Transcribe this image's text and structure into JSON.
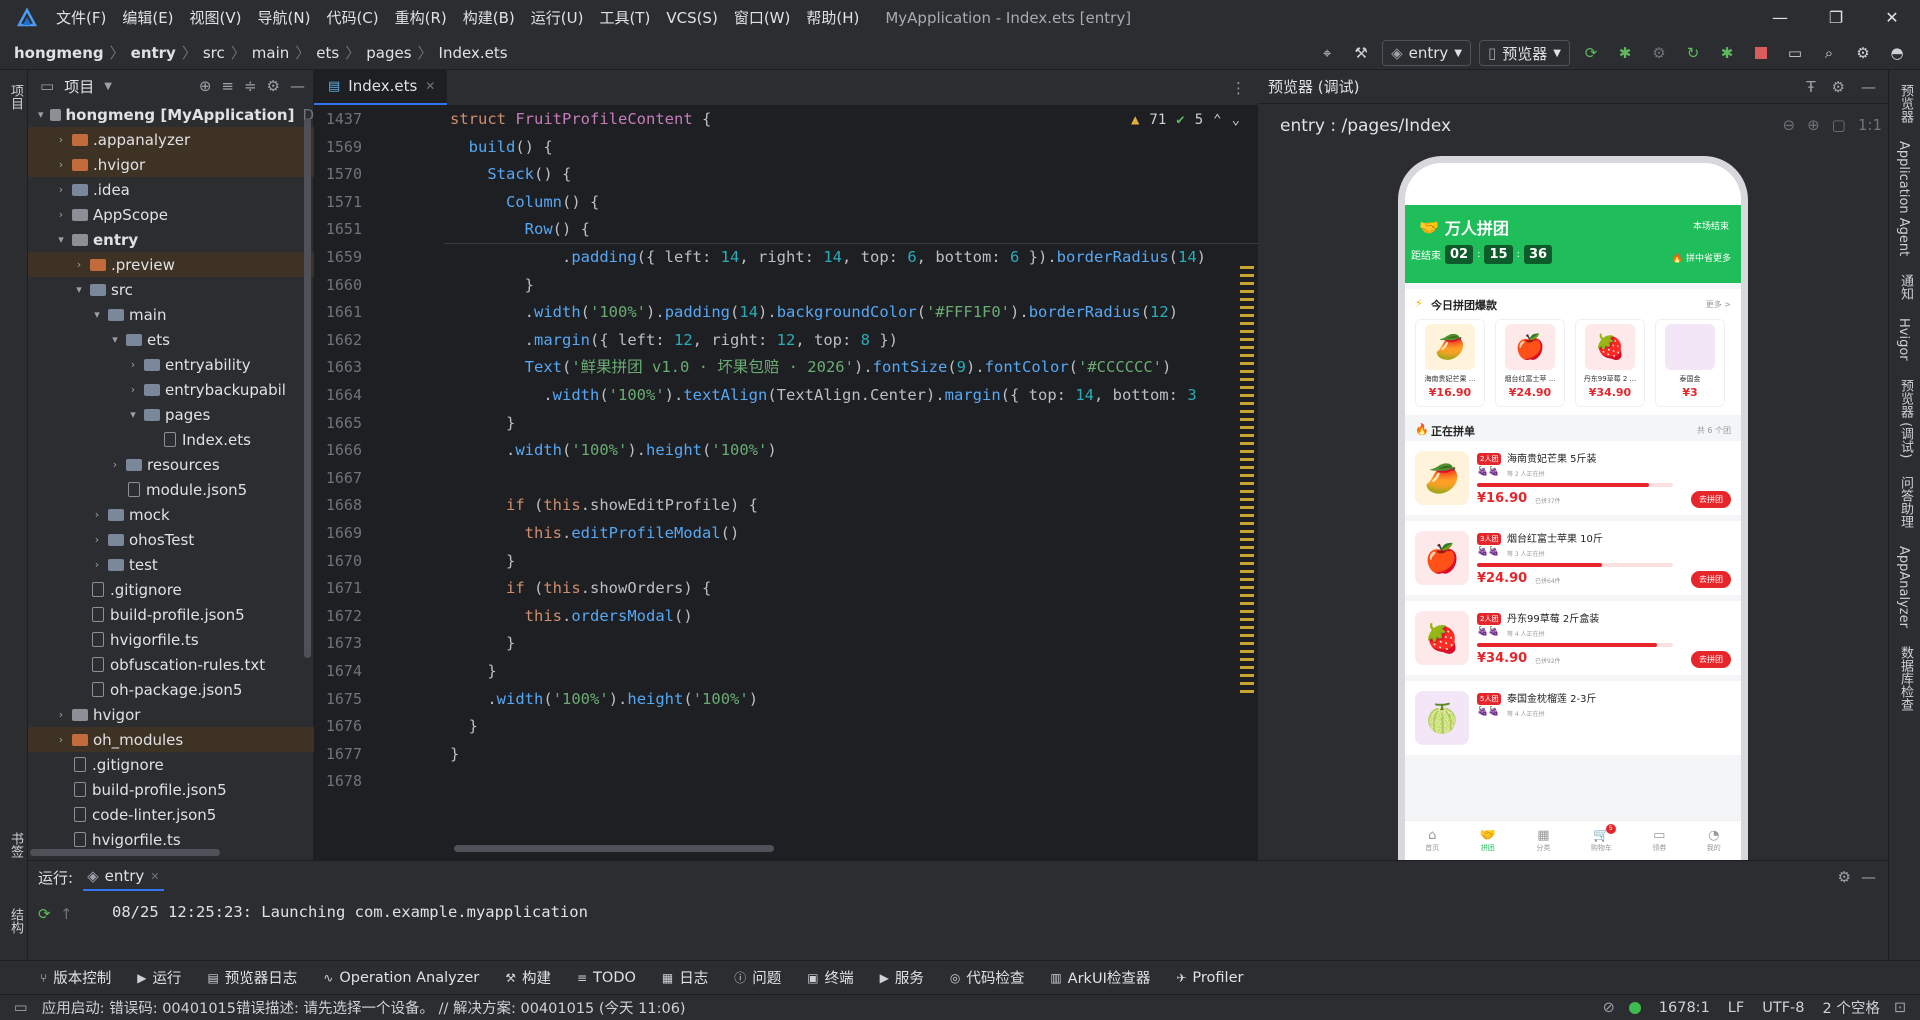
{
  "titlebar": {
    "menu": [
      "文件(F)",
      "编辑(E)",
      "视图(V)",
      "导航(N)",
      "代码(C)",
      "重构(R)",
      "构建(B)",
      "运行(U)",
      "工具(T)",
      "VCS(S)",
      "窗口(W)",
      "帮助(H)"
    ],
    "window_title": "MyApplication - Index.ets [entry]",
    "minimize": "—",
    "restore": "❐",
    "close": "✕"
  },
  "breadcrumb": [
    "hongmeng",
    "entry",
    "src",
    "main",
    "ets",
    "pages",
    "Index.ets"
  ],
  "toolbar": {
    "run_config": "entry",
    "device": "预览器"
  },
  "project": {
    "title": "项目",
    "items": [
      {
        "label": "hongmeng [MyApplication]",
        "suffix": "D",
        "depth": 0,
        "arrow": "▾",
        "icon": "gray",
        "hl": false,
        "bold": true
      },
      {
        "label": ".appanalyzer",
        "depth": 1,
        "arrow": "›",
        "icon": "orange",
        "hl": true
      },
      {
        "label": ".hvigor",
        "depth": 1,
        "arrow": "›",
        "icon": "orange",
        "hl": true
      },
      {
        "label": ".idea",
        "depth": 1,
        "arrow": "›",
        "icon": "blue",
        "hl": false
      },
      {
        "label": "AppScope",
        "depth": 1,
        "arrow": "›",
        "icon": "gray",
        "hl": false
      },
      {
        "label": "entry",
        "depth": 1,
        "arrow": "▾",
        "icon": "gray",
        "hl": false,
        "bold": true
      },
      {
        "label": ".preview",
        "depth": 2,
        "arrow": "›",
        "icon": "orange",
        "hl": true
      },
      {
        "label": "src",
        "depth": 2,
        "arrow": "▾",
        "icon": "blue",
        "hl": false
      },
      {
        "label": "main",
        "depth": 3,
        "arrow": "▾",
        "icon": "blue",
        "hl": false
      },
      {
        "label": "ets",
        "depth": 4,
        "arrow": "▾",
        "icon": "blue",
        "hl": false
      },
      {
        "label": "entryability",
        "depth": 5,
        "arrow": "›",
        "icon": "blue",
        "hl": false
      },
      {
        "label": "entrybackupabil",
        "depth": 5,
        "arrow": "›",
        "icon": "blue",
        "hl": false
      },
      {
        "label": "pages",
        "depth": 5,
        "arrow": "▾",
        "icon": "blue",
        "hl": false
      },
      {
        "label": "Index.ets",
        "depth": 6,
        "arrow": "",
        "icon": "file",
        "hl": false
      },
      {
        "label": "resources",
        "depth": 4,
        "arrow": "›",
        "icon": "blue",
        "hl": false
      },
      {
        "label": "module.json5",
        "depth": 4,
        "arrow": "",
        "icon": "file",
        "hl": false
      },
      {
        "label": "mock",
        "depth": 3,
        "arrow": "›",
        "icon": "blue",
        "hl": false
      },
      {
        "label": "ohosTest",
        "depth": 3,
        "arrow": "›",
        "icon": "blue",
        "hl": false
      },
      {
        "label": "test",
        "depth": 3,
        "arrow": "›",
        "icon": "blue",
        "hl": false
      },
      {
        "label": ".gitignore",
        "depth": 2,
        "arrow": "",
        "icon": "file",
        "hl": false
      },
      {
        "label": "build-profile.json5",
        "depth": 2,
        "arrow": "",
        "icon": "file",
        "hl": false
      },
      {
        "label": "hvigorfile.ts",
        "depth": 2,
        "arrow": "",
        "icon": "file",
        "hl": false
      },
      {
        "label": "obfuscation-rules.txt",
        "depth": 2,
        "arrow": "",
        "icon": "file",
        "hl": false
      },
      {
        "label": "oh-package.json5",
        "depth": 2,
        "arrow": "",
        "icon": "file",
        "hl": false
      },
      {
        "label": "hvigor",
        "depth": 1,
        "arrow": "›",
        "icon": "gray",
        "hl": false
      },
      {
        "label": "oh_modules",
        "depth": 1,
        "arrow": "›",
        "icon": "orange",
        "hl": true
      },
      {
        "label": ".gitignore",
        "depth": 1,
        "arrow": "",
        "icon": "file",
        "hl": false
      },
      {
        "label": "build-profile.json5",
        "depth": 1,
        "arrow": "",
        "icon": "file",
        "hl": false
      },
      {
        "label": "code-linter.json5",
        "depth": 1,
        "arrow": "",
        "icon": "file",
        "hl": false
      },
      {
        "label": "hvigorfile.ts",
        "depth": 1,
        "arrow": "",
        "icon": "file",
        "hl": false
      }
    ]
  },
  "editor": {
    "tab": "Index.ets",
    "warnings": "71",
    "ok": "5",
    "sticky": [
      {
        "ln": "1437",
        "html": "<span class='kw'>struct</span> <span class='ty'>FruitProfileContent</span> {"
      },
      {
        "ln": "1569",
        "html": "  <span class='fn'>build</span>() {"
      },
      {
        "ln": "1570",
        "html": "    <span class='fn'>Stack</span>() {"
      },
      {
        "ln": "1571",
        "html": "      <span class='fn'>Column</span>() {"
      },
      {
        "ln": "1651",
        "html": "        <span class='fn'>Row</span>() {"
      }
    ],
    "lines": [
      {
        "ln": "1659",
        "html": "            .<span class='fn'>padding</span>({ left: <span class='nm'>14</span>, right: <span class='nm'>14</span>, top: <span class='nm'>6</span>, bottom: <span class='nm'>6</span> }).<span class='fn'>borderRadius</span>(<span class='nm'>14</span>)"
      },
      {
        "ln": "1660",
        "html": "        }"
      },
      {
        "ln": "1661",
        "html": "        .<span class='fn'>width</span>(<span class='st'>'100%'</span>).<span class='fn'>padding</span>(<span class='nm'>14</span>).<span class='fn'>backgroundColor</span>(<span class='st'>'#FFF1F0'</span>).<span class='fn'>borderRadius</span>(<span class='nm'>12</span>)"
      },
      {
        "ln": "1662",
        "html": "        .<span class='fn'>margin</span>({ left: <span class='nm'>12</span>, right: <span class='nm'>12</span>, top: <span class='nm'>8</span> })"
      },
      {
        "ln": "1663",
        "html": "        <span class='fn'>Text</span>(<span class='st'>'鲜果拼团 v1.0 · 坏果包赔 · 2026'</span>).<span class='fn'>fontSize</span>(<span class='nm'>9</span>).<span class='fn'>fontColor</span>(<span class='st'>'#CCCCCC'</span>)"
      },
      {
        "ln": "1664",
        "html": "          .<span class='fn'>width</span>(<span class='st'>'100%'</span>).<span class='fn'>textAlign</span>(TextAlign.Center).<span class='fn'>margin</span>({ top: <span class='nm'>14</span>, bottom: <span class='nm'>3</span>"
      },
      {
        "ln": "1665",
        "html": "      }"
      },
      {
        "ln": "1666",
        "html": "      .<span class='fn'>width</span>(<span class='st'>'100%'</span>).<span class='fn'>height</span>(<span class='st'>'100%'</span>)"
      },
      {
        "ln": "1667",
        "html": ""
      },
      {
        "ln": "1668",
        "html": "      <span class='kw'>if</span> (<span class='kw'>this</span>.showEditProfile) {"
      },
      {
        "ln": "1669",
        "html": "        <span class='kw'>this</span>.<span class='fn'>editProfileModal</span>()"
      },
      {
        "ln": "1670",
        "html": "      }"
      },
      {
        "ln": "1671",
        "html": "      <span class='kw'>if</span> (<span class='kw'>this</span>.showOrders) {"
      },
      {
        "ln": "1672",
        "html": "        <span class='kw'>this</span>.<span class='fn'>ordersModal</span>()"
      },
      {
        "ln": "1673",
        "html": "      }"
      },
      {
        "ln": "1674",
        "html": "    }"
      },
      {
        "ln": "1675",
        "html": "    .<span class='fn'>width</span>(<span class='st'>'100%'</span>).<span class='fn'>height</span>(<span class='st'>'100%'</span>)"
      },
      {
        "ln": "1676",
        "html": "  }"
      },
      {
        "ln": "1677",
        "html": "}"
      },
      {
        "ln": "1678",
        "html": ""
      }
    ]
  },
  "preview": {
    "title": "预览器 (调试)",
    "path": "entry : /pages/Index",
    "app": {
      "brand": "万人拼团",
      "scope": "本场结束",
      "countdown_label": "距结束",
      "hh": "02",
      "mm": "15",
      "ss": "36",
      "hot_more": "拼中省更多",
      "section1": "今日拼团爆款",
      "more": "更多 >",
      "hot": [
        {
          "name": "海南贵妃芒果 ...",
          "price": "¥16.90",
          "emoji": "🥭",
          "bg": "#fff3dc"
        },
        {
          "name": "烟台红富士苹 ...",
          "price": "¥24.90",
          "emoji": "🍎",
          "bg": "#fde8ea"
        },
        {
          "name": "丹东99草莓 2 ...",
          "price": "¥34.90",
          "emoji": "🍓",
          "bg": "#fde8ea"
        },
        {
          "name": "泰国金",
          "price": "¥3",
          "emoji": "",
          "bg": "#f3e6f7"
        }
      ],
      "section2": "正在拼单",
      "count": "共 6 个团",
      "groups": [
        {
          "tag": "2人团",
          "name": "海南贵妃芒果 5斤装",
          "sub": "等 2 人正在拼",
          "price": "¥16.90",
          "sold": "已拼37件",
          "btn": "去拼团",
          "emoji": "🥭",
          "bg": "#fff3dc",
          "progress": 0.88
        },
        {
          "tag": "3人团",
          "name": "烟台红富士苹果 10斤",
          "sub": "等 3 人正在拼",
          "price": "¥24.90",
          "sold": "已拼64件",
          "btn": "去拼团",
          "emoji": "🍎",
          "bg": "#fde8ea",
          "progress": 0.64
        },
        {
          "tag": "2人团",
          "name": "丹东99草莓 2斤盒装",
          "sub": "等 4 人正在拼",
          "price": "¥34.90",
          "sold": "已拼92件",
          "btn": "去拼团",
          "emoji": "🍓",
          "bg": "#fde8ea",
          "progress": 0.92
        },
        {
          "tag": "5人团",
          "name": "泰国金枕榴莲 2-3斤",
          "sub": "等 4 人正在拼",
          "price": "",
          "sold": "",
          "btn": "",
          "emoji": "🍈",
          "bg": "#f3e6f7",
          "progress": 0
        }
      ],
      "nav": [
        "首页",
        "拼团",
        "分类",
        "购物车",
        "领券",
        "我的"
      ],
      "cart_badge": "5"
    }
  },
  "bottom": {
    "label": "运行:",
    "tab": "entry",
    "console": "08/25 12:25:23: Launching com.example.myapplication"
  },
  "toolwindows": [
    "版本控制",
    "运行",
    "预览器日志",
    "Operation Analyzer",
    "构建",
    "TODO",
    "日志",
    "问题",
    "终端",
    "服务",
    "代码检查",
    "ArkUI检查器",
    "Profiler"
  ],
  "status": {
    "message": "应用启动: 错误码: 00401015错误描述: 请先选择一个设备。 // 解决方案: 00401015 (今天 11:06)",
    "position": "1678:1",
    "line_sep": "LF",
    "encoding": "UTF-8",
    "indent": "2 个空格"
  },
  "left_strip": {
    "top": "项目",
    "bottom": "书签",
    "bottom2": "结构"
  },
  "right_strip": [
    "预览器",
    "Application Agent",
    "通知",
    "Hvigor",
    "预览器 (调试)",
    "问答助理",
    "AppAnalyzer",
    "数据库检查"
  ]
}
